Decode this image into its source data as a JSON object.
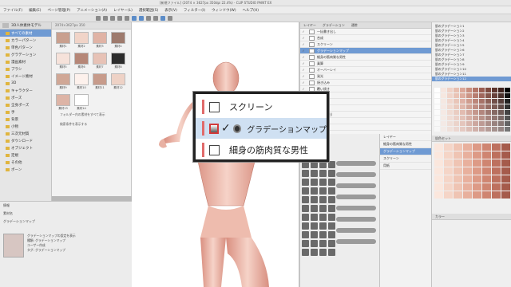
{
  "window": {
    "title": "[新規ファイル] (2074 × 3627px 350dpi 22.4%) - CLIP STUDIO PAINT EX"
  },
  "menu": [
    "ファイル(F)",
    "編集(E)",
    "ページ管理(P)",
    "アニメーション(A)",
    "レイヤー(L)",
    "選択範囲(S)",
    "表示(V)",
    "フィルター(I)",
    "ウィンドウ(W)",
    "ヘルプ(H)"
  ],
  "left_panel": {
    "search_label": "3D人体素体モデル",
    "tree": [
      "すべての素材",
      "カラーパターン",
      "単色パターン",
      "グラデーション",
      "漫画素材",
      "ブラシ",
      "イメージ素材",
      "3D",
      "キャラクター",
      "ポーズ",
      "全身ポーズ",
      "手",
      "背景",
      "小物",
      "三次元材質",
      "ダウンロード",
      "オブジェクト",
      "定規",
      "その他",
      "ボーン"
    ],
    "selected_index": 0
  },
  "material_grid": {
    "header": "2074×3627px 350",
    "items": [
      "素材1",
      "素材2",
      "素材3",
      "素材4",
      "素材5",
      "素材6",
      "素材7",
      "素材8",
      "素材9",
      "素材10",
      "素材11",
      "素材12",
      "素材13",
      "素材14"
    ],
    "note1": "フォルダー内の素材をすべて表示",
    "note2": "検索条件を表示する"
  },
  "properties": {
    "header": "情報",
    "line1": "素材名",
    "line2": "グラデーションマップ",
    "desc": [
      "グラデーションマップの設定を表示",
      "種類: グラデーションマップ",
      "ユーザー作成",
      "タグ: グラデーションマップ"
    ]
  },
  "callout": {
    "rows": [
      {
        "label": "スクリーン"
      },
      {
        "label": "グラデーションマップ",
        "checked": "✓"
      },
      {
        "label": "細身の筋肉質な男性"
      }
    ]
  },
  "layer_list": {
    "tabs": [
      "レイヤー",
      "グラデーション",
      "通常"
    ],
    "rows": [
      "一括書き出し",
      "合成",
      "スクリーン",
      "グラデーションマップ",
      "細身の筋肉質な男性",
      "乗算",
      "オーバーレイ",
      "発光",
      "焼き込み",
      "覆い焼き",
      "比較(暗)",
      "比較(明)",
      "加算",
      "加算(発光)",
      "色相",
      "彩度",
      "カラー"
    ],
    "selected": 3
  },
  "layer_panel2": {
    "rows": [
      "レイヤー",
      "細身の筋肉質な男性",
      "グラデーションマップ",
      "スクリーン",
      "用紙"
    ],
    "selected": 2
  },
  "right_panel": {
    "list": [
      "肌のグラデーション1",
      "肌のグラデーション2",
      "肌のグラデーション3",
      "肌のグラデーション4",
      "肌のグラデーション5",
      "肌のグラデーション6",
      "肌のグラデーション7",
      "肌のグラデーション8",
      "肌のグラデーション9",
      "肌のグラデーション10",
      "肌のグラデーション11",
      "肌のグラデーション12"
    ],
    "selected": 11,
    "head2": "肌色セット",
    "head3": "カラー"
  },
  "colors": {
    "accent": "#6f9ad3",
    "highlight": "#d23a3a",
    "skin": "#f0c3b6"
  }
}
